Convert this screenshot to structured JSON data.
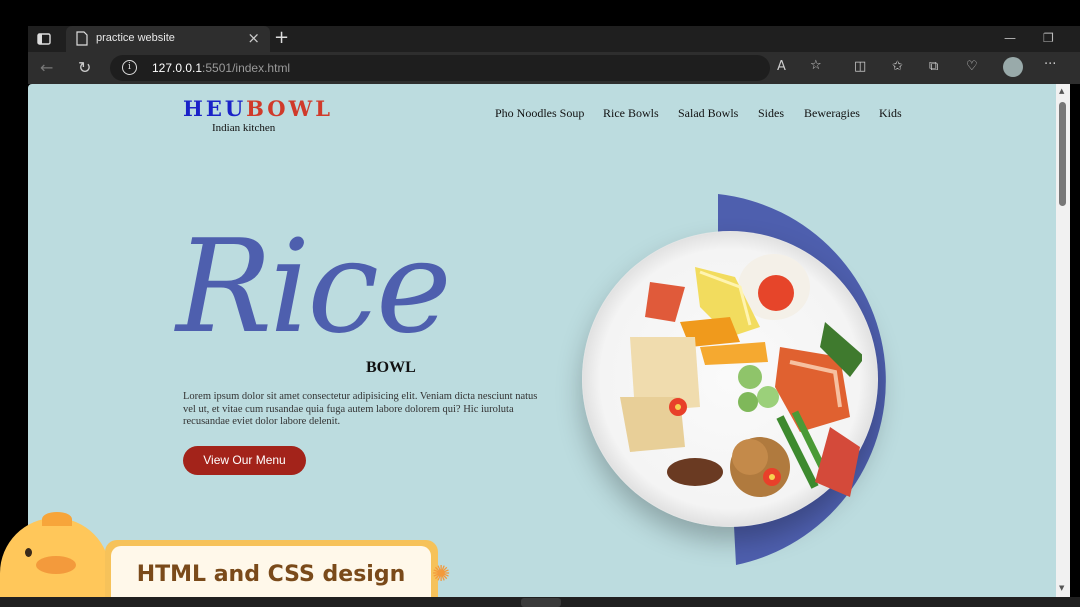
{
  "browser": {
    "tab_title": "practice website",
    "url_host": "127.0.0.1",
    "url_path": ":5501/index.html"
  },
  "site": {
    "logo": {
      "part1": "HEU",
      "part2": "BO",
      "part3": "WL"
    },
    "tagline": "Indian kitchen",
    "nav": [
      "Pho Noodles Soup",
      "Rice Bowls",
      "Salad Bowls",
      "Sides",
      "Beweragies",
      "Kids"
    ],
    "hero": {
      "title": "Rice",
      "subtitle": "BOWL",
      "description": "Lorem ipsum dolor sit amet consectetur adipisicing elit. Veniam dicta nesciunt natus vel ut, et vitae cum rusandae quia fuga autem labore dolorem qui? Hic iuroluta recusandae eviet dolor labore delenit.",
      "button": "View Our Menu"
    },
    "colors": {
      "background": "#bcdcdf",
      "accent": "#4e5fae",
      "button": "#a3231a",
      "logo_blue": "#1a22c8",
      "logo_red": "#d03a2a"
    }
  },
  "overlay": {
    "banner_text": "HTML and CSS design"
  },
  "icons": [
    "tab-actions-icon",
    "document-icon",
    "close-icon",
    "new-tab-icon",
    "back-icon",
    "refresh-icon",
    "info-icon",
    "read-aloud-icon",
    "favorite-icon",
    "split-screen-icon",
    "favorites-icon",
    "collections-icon",
    "health-icon",
    "profile-icon",
    "more-icon"
  ]
}
